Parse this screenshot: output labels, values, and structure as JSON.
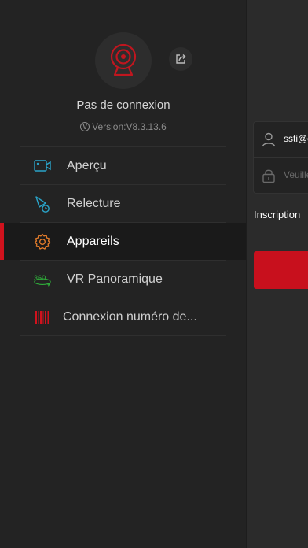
{
  "drawer": {
    "status_text": "Pas de connexion",
    "version_text": "Version:V8.3.13.6",
    "version_badge": "V",
    "accent_color": "#d0121d",
    "menu": [
      {
        "label": "Aperçu",
        "icon": "preview-camera-icon",
        "active": false
      },
      {
        "label": "Relecture",
        "icon": "playback-icon",
        "active": false
      },
      {
        "label": "Appareils",
        "icon": "gear-icon",
        "active": true
      },
      {
        "label": "VR Panoramique",
        "icon": "vr-360-icon",
        "active": false
      },
      {
        "label": "Connexion numéro de...",
        "icon": "barcode-icon",
        "active": false
      }
    ]
  },
  "login": {
    "username_value": "ssti@e",
    "password_placeholder": "Veuille",
    "signup_label": "Inscription"
  }
}
